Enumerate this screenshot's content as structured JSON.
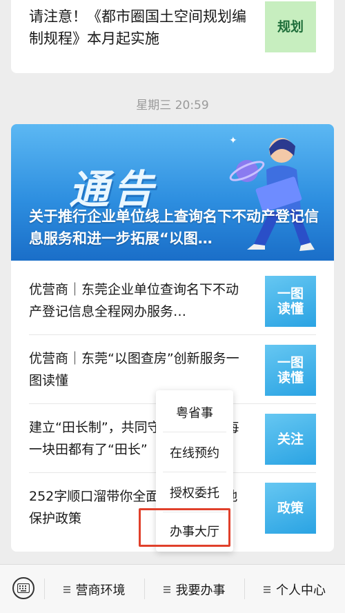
{
  "top_article": {
    "title": "请注意！《都市圈国土空间规划编制规程》本月起实施",
    "thumb": "规划"
  },
  "timestamp": "星期三 20:59",
  "banner": {
    "big_text": "通告",
    "headline": "关于推行企业单位线上查询名下不动产登记信息服务和进一步拓展“以图…"
  },
  "articles": [
    {
      "title": "优营商｜东莞企业单位查询名下不动产登记信息全程网办服务…",
      "thumb": "一图\n读懂"
    },
    {
      "title": "优营商｜东莞“以图查房”创新服务一图读懂",
      "thumb": "一图\n读懂"
    },
    {
      "title": "建立“田长制”，共同守护耕地！让每一块田都有了“田长”",
      "thumb": "关注"
    },
    {
      "title": "252字顺口溜带你全面了解东莞耕地保护政策",
      "thumb": "政策"
    }
  ],
  "popup_menu": [
    "粤省事",
    "在线预约",
    "授权委托",
    "办事大厅"
  ],
  "tabbar": {
    "tabs": [
      "营商环境",
      "我要办事",
      "个人中心"
    ]
  },
  "colors": {
    "accent_blue": "#2aa3e3",
    "highlight_red": "#e0402b",
    "thumb_green": "#c7eebf"
  },
  "icons": {
    "keyboard": "keyboard-icon",
    "menu": "menu-lines-icon"
  }
}
